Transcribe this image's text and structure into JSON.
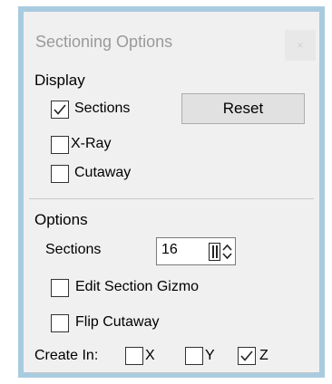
{
  "window": {
    "title": "Sectioning Options",
    "close_glyph": "×"
  },
  "display": {
    "header": "Display",
    "sections_label": "Sections",
    "sections_checked": true,
    "xray_label": "X-Ray",
    "xray_checked": false,
    "cutaway_label": "Cutaway",
    "cutaway_checked": false,
    "reset_label": "Reset"
  },
  "options": {
    "header": "Options",
    "sections_label": "Sections",
    "sections_value": "16",
    "edit_gizmo_label": "Edit Section Gizmo",
    "edit_gizmo_checked": false,
    "flip_cutaway_label": "Flip Cutaway",
    "flip_cutaway_checked": false,
    "create_in_label": "Create In:",
    "axis_x_label": "X",
    "axis_x_checked": false,
    "axis_y_label": "Y",
    "axis_y_checked": false,
    "axis_z_label": "Z",
    "axis_z_checked": true
  },
  "colors": {
    "frame_border": "#a9cbe0",
    "panel_bg": "#f0f0f0",
    "button_bg": "#e1e1e1"
  }
}
